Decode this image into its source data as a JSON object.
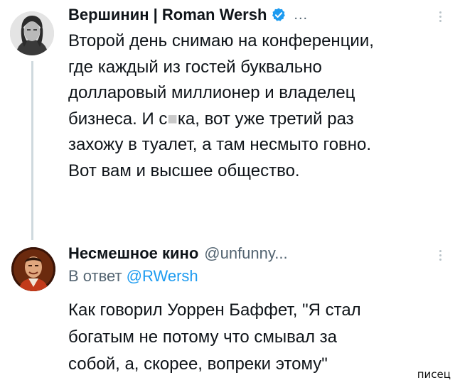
{
  "tweet1": {
    "author_name": "Вершинин | Roman Wersh",
    "verified_icon": "verified-badge-icon",
    "more_text": "...",
    "lines": [
      "Второй день снимаю на конференции,",
      "где каждый из гостей буквально",
      "долларовый миллионер и владелец",
      "бизнеса. И с",
      "ка, вот уже третий раз",
      "захожу в туалет, а там несмыто говно.",
      "Вот вам и высшее общество."
    ],
    "censored_fragment": "■"
  },
  "tweet2": {
    "author_name": "Несмешное кино",
    "author_handle": "@unfunny...",
    "reply_prefix": "В ответ",
    "reply_mention": "@RWersh",
    "lines": [
      "Как говорил Уоррен Баффет, \"Я стал",
      "богатым не потому что смывал за",
      "собой, а, скорее, вопреки этому\""
    ]
  },
  "watermark": "писец",
  "colors": {
    "text": "#0f1419",
    "muted": "#536471",
    "link": "#1d9bf0",
    "verified": "#1d9bf0",
    "thread_line": "#cfd9de"
  }
}
